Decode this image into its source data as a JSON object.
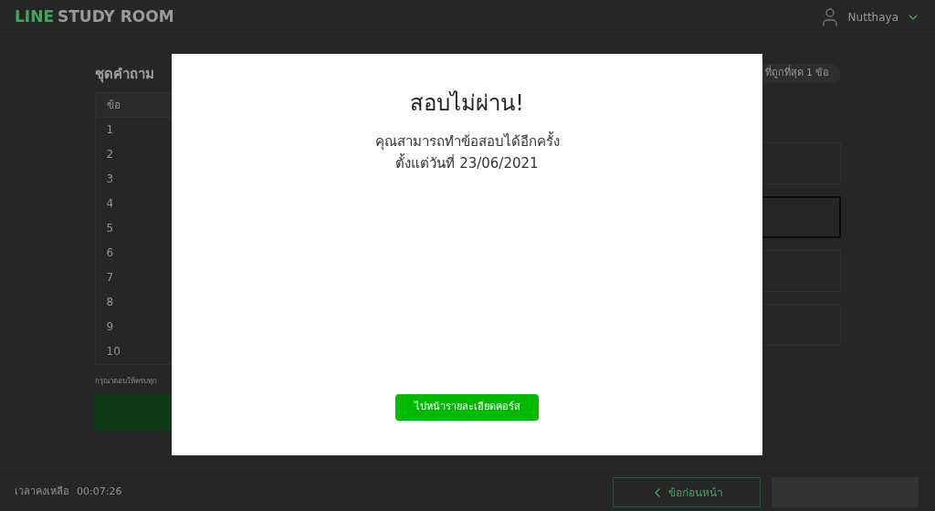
{
  "header": {
    "logo": {
      "brand": "LINE",
      "product": "STUDY ROOM"
    },
    "user": {
      "name": "Nutthaya"
    }
  },
  "question_set": {
    "title": "ชุดคำถาม",
    "column": "ข้อ",
    "rows": [
      "1",
      "2",
      "3",
      "4",
      "5",
      "6",
      "7",
      "8",
      "9",
      "10"
    ],
    "note": "กรุณาตอบให้ครบทุก"
  },
  "question": {
    "hint": "ที่ถูกที่สุด 1 ข้อ",
    "choices": [
      {
        "selected": false
      },
      {
        "selected": true
      },
      {
        "selected": false
      },
      {
        "selected": false
      }
    ]
  },
  "footer": {
    "time_label": "เวลาคงเหลือ",
    "time": "00:07:26",
    "prev_button": "ข้อก่อนหน้า",
    "next_button": {
      "disabled": true
    }
  },
  "dialog": {
    "title": "สอบไม่ผ่าน!",
    "message_lines": [
      "คุณสามารถทำข้อสอบได้อีกครั้ง",
      "ตั้งแต่วันที่ 23/06/2021"
    ],
    "button": "ไปหน้ารายละเอียดคอร์ส"
  }
}
